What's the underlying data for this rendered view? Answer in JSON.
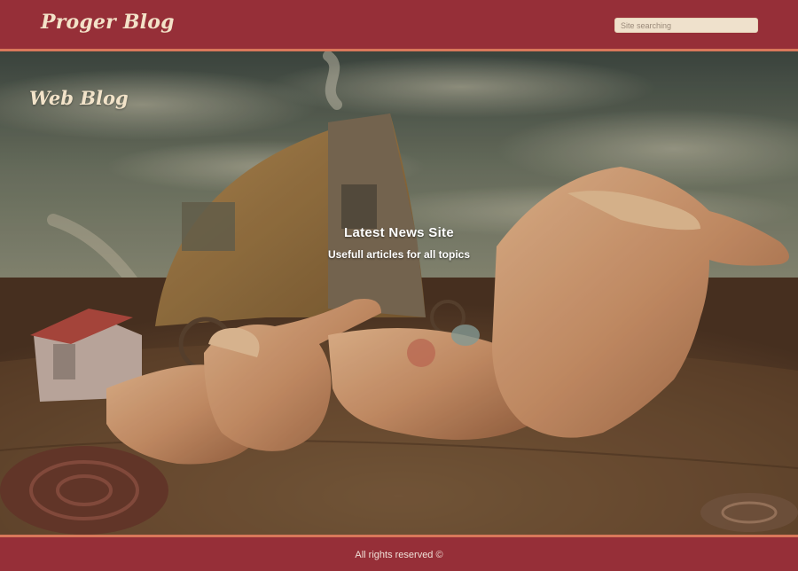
{
  "header": {
    "brand": "Proger Blog",
    "search_placeholder": "Site searching",
    "background_color": "#962f38",
    "accent_color": "#d8785a"
  },
  "hero": {
    "blog_title": "Web Blog",
    "headline": "Latest News Site",
    "subline": "Usefull articles for all topics",
    "image_description_icon": "surreal-landscape-image"
  },
  "footer": {
    "text": "All rights reserved ©"
  }
}
